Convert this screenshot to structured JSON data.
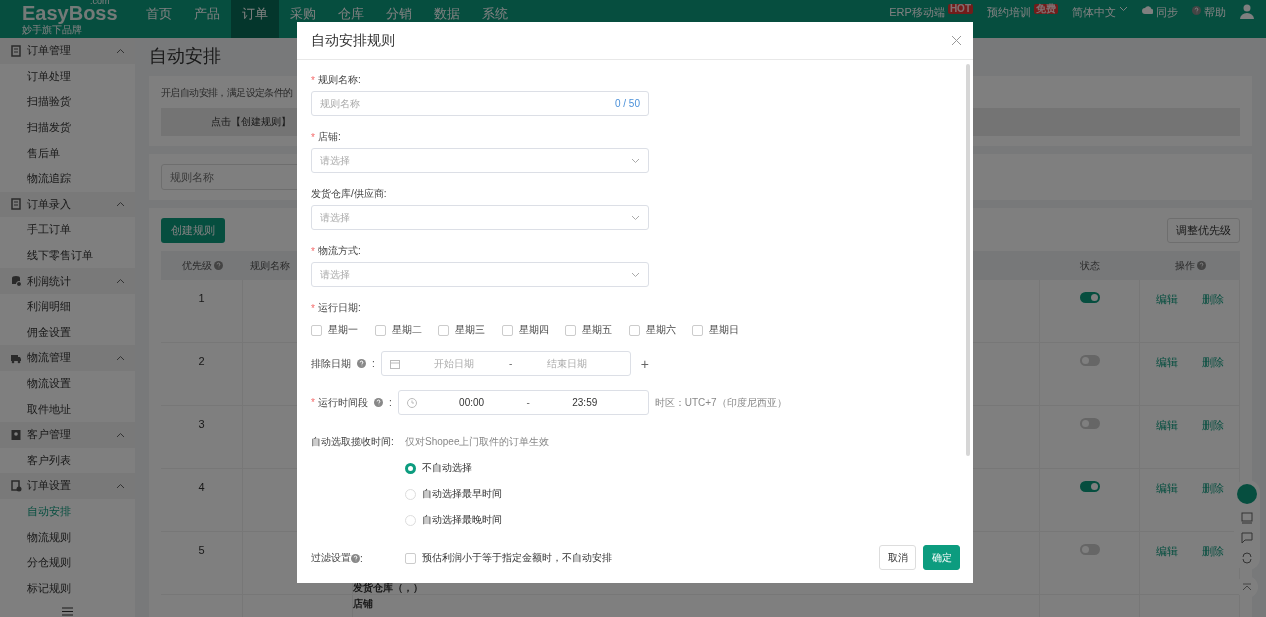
{
  "nav": {
    "logo": "EasyBoss",
    "logo_suffix": ".com",
    "logo_tagline": "妙手旗下品牌",
    "items": [
      {
        "label": "首页",
        "selected": false
      },
      {
        "label": "产品",
        "selected": false
      },
      {
        "label": "订单",
        "selected": true
      },
      {
        "label": "采购",
        "selected": false
      },
      {
        "label": "仓库",
        "selected": false
      },
      {
        "label": "分销",
        "selected": false
      },
      {
        "label": "数据",
        "selected": false
      },
      {
        "label": "系统",
        "selected": false
      }
    ],
    "right": [
      {
        "kind": "badge",
        "label": "ERP移动端",
        "badge": "HOT"
      },
      {
        "kind": "badge",
        "label": "预约培训",
        "badge": "免费"
      },
      {
        "kind": "dropdown",
        "label": "简体中文"
      },
      {
        "kind": "cloud",
        "label": "同步"
      },
      {
        "kind": "help",
        "label": "帮助"
      },
      {
        "kind": "user"
      }
    ]
  },
  "sidebar": [
    {
      "label": "订单管理",
      "kind": "doc",
      "expanded": true,
      "children": [
        {
          "label": "订单处理",
          "selected": false
        },
        {
          "label": "扫描验货",
          "selected": false
        },
        {
          "label": "扫描发货",
          "selected": false
        },
        {
          "label": "售后单",
          "selected": false
        },
        {
          "label": "物流追踪",
          "selected": false
        }
      ]
    },
    {
      "label": "订单录入",
      "kind": "doc",
      "expanded": true,
      "children": [
        {
          "label": "手工订单",
          "selected": false
        },
        {
          "label": "线下零售订单",
          "selected": false
        }
      ]
    },
    {
      "label": "利润统计",
      "kind": "coin",
      "expanded": true,
      "children": [
        {
          "label": "利润明细",
          "selected": false
        },
        {
          "label": "佣金设置",
          "selected": false
        }
      ]
    },
    {
      "label": "物流管理",
      "kind": "truck",
      "expanded": true,
      "children": [
        {
          "label": "物流设置",
          "selected": false
        },
        {
          "label": "取件地址",
          "selected": false
        }
      ]
    },
    {
      "label": "客户管理",
      "kind": "person",
      "expanded": true,
      "children": [
        {
          "label": "客户列表",
          "selected": false
        }
      ]
    },
    {
      "label": "订单设置",
      "kind": "gear",
      "expanded": true,
      "children": [
        {
          "label": "自动安排",
          "selected": true
        },
        {
          "label": "物流规则",
          "selected": false
        },
        {
          "label": "分仓规则",
          "selected": false
        },
        {
          "label": "标记规则",
          "selected": false
        }
      ]
    }
  ],
  "page": {
    "title": "自动安排",
    "intro": "开启自动安排，满足设定条件的",
    "banner": "点击【创建规则】",
    "search_placeholder": "规则名称",
    "create_button": "创建规则",
    "priority_button": "调整优先级",
    "table": {
      "columns": [
        {
          "label": "优先级",
          "help": true
        },
        {
          "label": "规则名称",
          "help": false
        },
        {
          "label": "状态",
          "help": false
        },
        {
          "label": "操作",
          "help": true
        }
      ],
      "rows": [
        {
          "priority": "1",
          "lines": [],
          "enabled": true,
          "actions": [
            "编辑",
            "删除"
          ]
        },
        {
          "priority": "2",
          "lines": [],
          "enabled": false,
          "actions": [
            "编辑",
            "删除"
          ]
        },
        {
          "priority": "3",
          "lines": [],
          "enabled": false,
          "actions": [
            "编辑",
            "删除"
          ]
        },
        {
          "priority": "4",
          "lines": [],
          "enabled": true,
          "actions": [
            "编辑",
            "删除"
          ]
        },
        {
          "priority": "5",
          "lines": [
            "发货仓库（，）"
          ],
          "enabled": false,
          "actions": [
            "编辑",
            "删除"
          ]
        },
        {
          "lines": [
            "店铺"
          ]
        }
      ]
    }
  },
  "modal": {
    "title": "自动安排规则",
    "required_mark": "*",
    "fields": [
      {
        "kind": "text",
        "label": "规则名称:",
        "required": true,
        "placeholder": "规则名称",
        "counter": "0 / 50"
      },
      {
        "kind": "select",
        "label": "店铺:",
        "required": true,
        "placeholder": "请选择"
      },
      {
        "kind": "select",
        "label": "发货仓库/供应商:",
        "required": false,
        "placeholder": "请选择"
      },
      {
        "kind": "select",
        "label": "物流方式:",
        "required": true,
        "placeholder": "请选择"
      },
      {
        "kind": "days",
        "label": "运行日期:",
        "required": true,
        "days": [
          {
            "label": "星期一",
            "checked": false
          },
          {
            "label": "星期二",
            "checked": false
          },
          {
            "label": "星期三",
            "checked": false
          },
          {
            "label": "星期四",
            "checked": false
          },
          {
            "label": "星期五",
            "checked": false
          },
          {
            "label": "星期六",
            "checked": false
          },
          {
            "label": "星期日",
            "checked": false
          }
        ]
      }
    ],
    "exclude_dates": {
      "label": "排除日期",
      "suffix": ":",
      "start_placeholder": "开始日期",
      "separator": "-",
      "end_placeholder": "结束日期",
      "add": "+"
    },
    "run_time": {
      "label": "运行时间段",
      "suffix": ":",
      "required": true,
      "start": "00:00",
      "separator": "-",
      "end": "23:59",
      "timezone": "时区：UTC+7（印度尼西亚）"
    },
    "pickup": {
      "label": "自动选取揽收时间:",
      "hint": "仅对Shopee上门取件的订单生效",
      "options": [
        {
          "label": "不自动选择",
          "selected": true
        },
        {
          "label": "自动选择最早时间",
          "selected": false
        },
        {
          "label": "自动选择最晚时间",
          "selected": false
        }
      ]
    },
    "filter": {
      "label": "过滤设置",
      "suffix": ":",
      "option": {
        "label": "预估利润小于等于指定金额时，不自动安排",
        "checked": false
      }
    },
    "buttons": [
      {
        "kind": "secondary",
        "label": "取消"
      },
      {
        "kind": "primary",
        "label": "确定"
      }
    ]
  }
}
